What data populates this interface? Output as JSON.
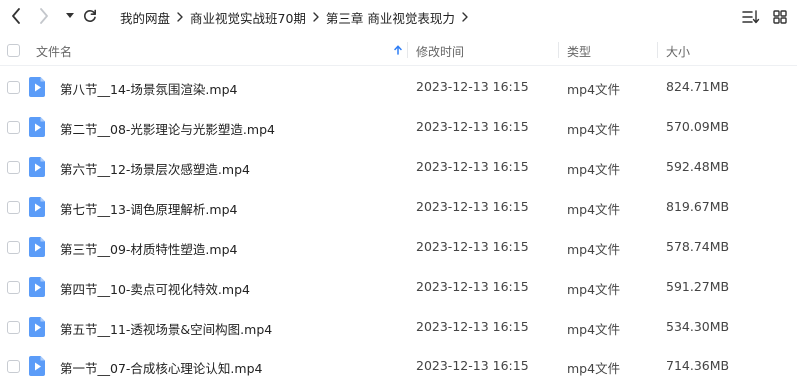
{
  "breadcrumb": {
    "items": [
      "我的网盘",
      "商业视觉实战班70期",
      "第三章 商业视觉表现力"
    ]
  },
  "columns": {
    "name": "文件名",
    "modified": "修改时间",
    "type": "类型",
    "size": "大小"
  },
  "sort": {
    "column": "name",
    "direction": "ascending"
  },
  "icons": {
    "back": "chevron-left-icon",
    "forward": "chevron-right-icon",
    "history": "caret-down-icon",
    "refresh": "refresh-icon",
    "sort": "sort-list-icon",
    "view": "grid-view-icon",
    "file": "video-file-icon"
  },
  "colors": {
    "accent": "#2f7ef5",
    "file_icon": "#5b9cf8"
  },
  "files": [
    {
      "name": "第八节__14-场景氛围渲染.mp4",
      "modified": "2023-12-13 16:15",
      "type": "mp4文件",
      "size": "824.71MB"
    },
    {
      "name": "第二节__08-光影理论与光影塑造.mp4",
      "modified": "2023-12-13 16:15",
      "type": "mp4文件",
      "size": "570.09MB"
    },
    {
      "name": "第六节__12-场景层次感塑造.mp4",
      "modified": "2023-12-13 16:15",
      "type": "mp4文件",
      "size": "592.48MB"
    },
    {
      "name": "第七节__13-调色原理解析.mp4",
      "modified": "2023-12-13 16:15",
      "type": "mp4文件",
      "size": "819.67MB"
    },
    {
      "name": "第三节__09-材质特性塑造.mp4",
      "modified": "2023-12-13 16:15",
      "type": "mp4文件",
      "size": "578.74MB"
    },
    {
      "name": "第四节__10-卖点可视化特效.mp4",
      "modified": "2023-12-13 16:15",
      "type": "mp4文件",
      "size": "591.27MB"
    },
    {
      "name": "第五节__11-透视场景&空间构图.mp4",
      "modified": "2023-12-13 16:15",
      "type": "mp4文件",
      "size": "534.30MB"
    },
    {
      "name": "第一节__07-合成核心理论认知.mp4",
      "modified": "2023-12-13 16:15",
      "type": "mp4文件",
      "size": "714.36MB"
    }
  ]
}
